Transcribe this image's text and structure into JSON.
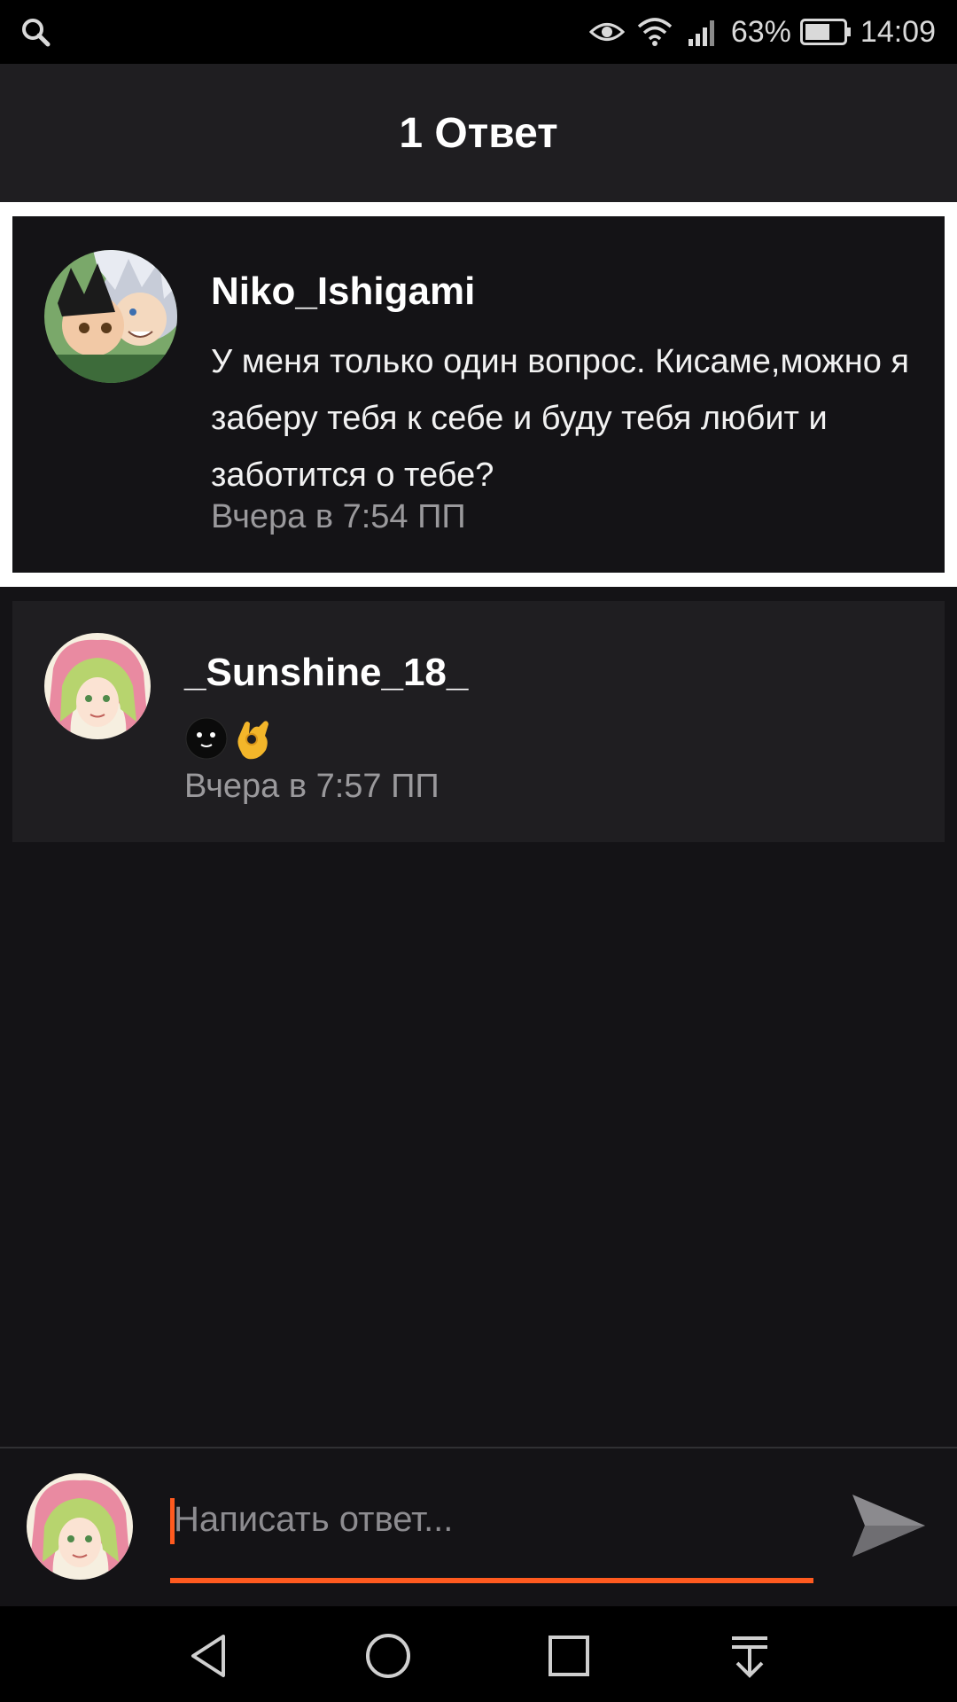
{
  "status_bar": {
    "battery_percent": "63%",
    "time": "14:09",
    "icons": [
      "search-icon",
      "eye-icon",
      "wifi-icon",
      "signal-icon",
      "battery-icon"
    ]
  },
  "header": {
    "title": "1 Ответ"
  },
  "parent_comment": {
    "username": "Niko_Ishigami",
    "text": "У меня только один вопрос. Кисаме,можно я заберу тебя к себе и буду тебя любит и заботится о тебе?",
    "timestamp": "Вчера в 7:54 ПП"
  },
  "reply": {
    "username": "_Sunshine_18_",
    "emoji": [
      "smiling-face-emoji",
      "ok-hand-emoji"
    ],
    "timestamp": "Вчера в 7:57 ПП"
  },
  "composer": {
    "placeholder": "Написать ответ...",
    "value": "",
    "accent": "#ff5a1f"
  },
  "nav_bar": {
    "icons": [
      "back-icon",
      "home-icon",
      "recents-icon",
      "notifications-pull-icon"
    ]
  }
}
